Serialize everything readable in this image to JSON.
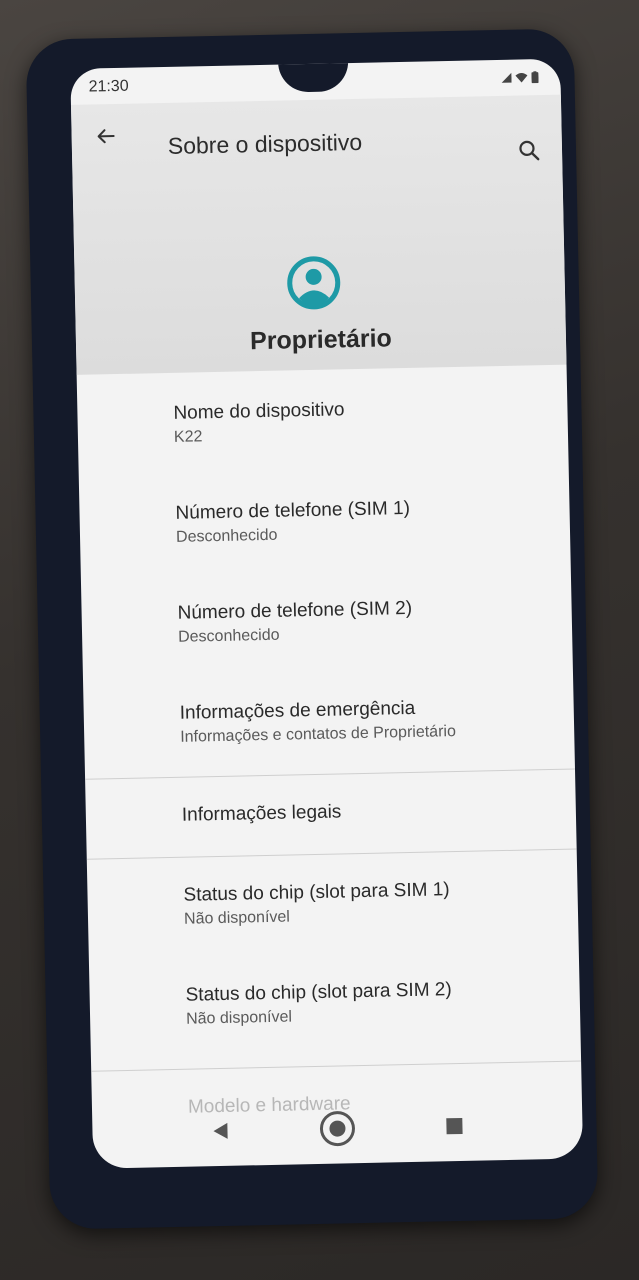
{
  "status_bar": {
    "time": "21:30"
  },
  "header": {
    "title": "Sobre o dispositivo",
    "owner_label": "Proprietário"
  },
  "items": [
    {
      "title": "Nome do dispositivo",
      "subtitle": "K22"
    },
    {
      "title": "Número de telefone (SIM 1)",
      "subtitle": "Desconhecido"
    },
    {
      "title": "Número de telefone (SIM 2)",
      "subtitle": "Desconhecido"
    },
    {
      "title": "Informações de emergência",
      "subtitle": "Informações e contatos de Proprietário"
    },
    {
      "title": "Informações legais",
      "subtitle": ""
    },
    {
      "title": "Status do chip (slot para SIM 1)",
      "subtitle": "Não disponível"
    },
    {
      "title": "Status do chip (slot para SIM 2)",
      "subtitle": "Não disponível"
    },
    {
      "title": "Modelo e hardware",
      "subtitle": ""
    }
  ],
  "icons": {
    "back": "arrow-left-icon",
    "search": "search-icon",
    "avatar": "account-circle-icon",
    "nav_back": "triangle-back-icon",
    "nav_home": "circle-home-icon",
    "nav_recent": "square-recent-icon"
  },
  "colors": {
    "accent": "#1e9aa6",
    "screen_bg": "#f3f3f3",
    "header_bg": "#dedede"
  }
}
